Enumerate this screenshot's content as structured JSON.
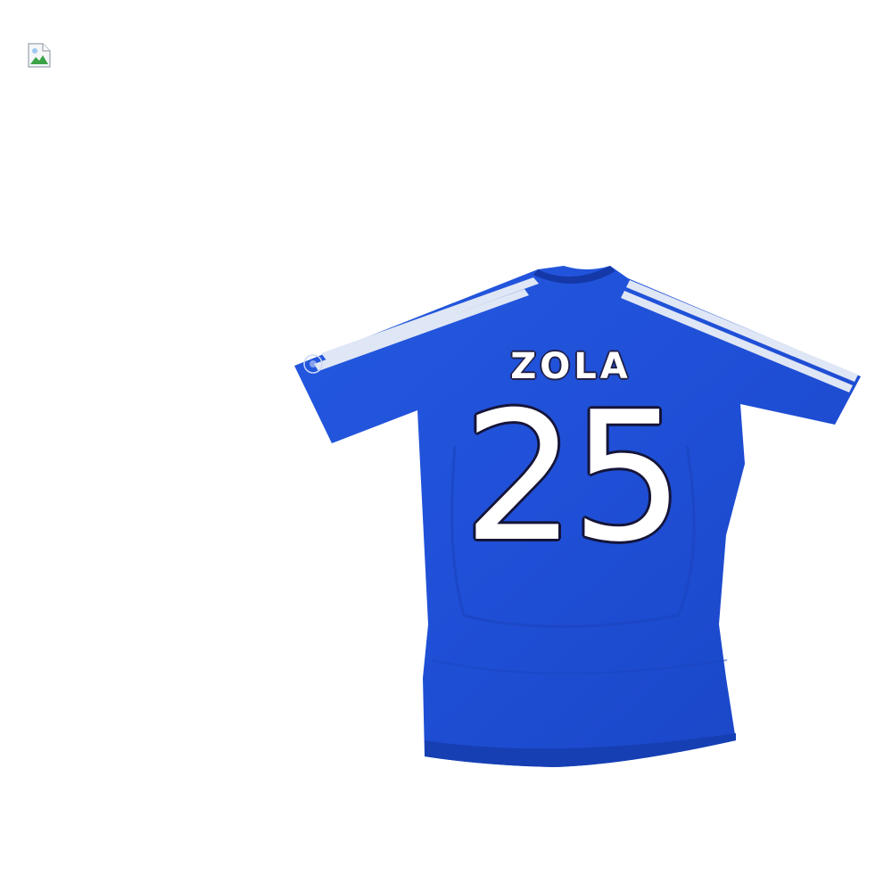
{
  "colors": {
    "shirt_blue": "#1f4fd6",
    "shirt_blue_dark": "#1740bf",
    "stripe_white": "#dfe6f5",
    "number_outline": "#15153a"
  },
  "icons": {
    "broken_image": "broken-image-icon",
    "sleeve_badge": "football-badge-icon"
  },
  "shirt": {
    "name": "ZOLA",
    "number": "25"
  }
}
